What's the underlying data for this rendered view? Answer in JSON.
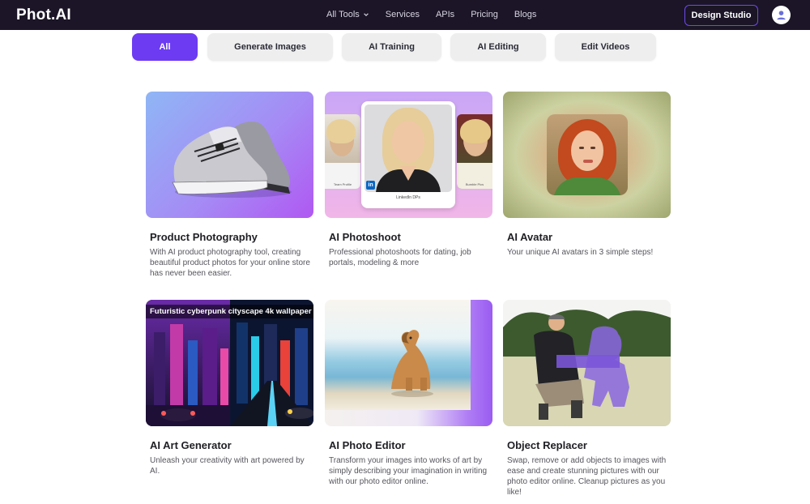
{
  "header": {
    "logo": "Phot.AI",
    "nav": [
      {
        "label": "All Tools",
        "dropdown": true
      },
      {
        "label": "Services"
      },
      {
        "label": "APIs"
      },
      {
        "label": "Pricing"
      },
      {
        "label": "Blogs"
      }
    ],
    "cta_label": "Design Studio",
    "avatar_icon": "user-icon"
  },
  "tabs": [
    {
      "label": "All",
      "active": true
    },
    {
      "label": "Generate Images"
    },
    {
      "label": "AI Training"
    },
    {
      "label": "AI Editing"
    },
    {
      "label": "Edit Videos"
    }
  ],
  "cards": [
    {
      "title": "Product Photography",
      "desc": "With AI product photography tool, creating beautiful product photos for your online store has never been easier."
    },
    {
      "title": "AI Photoshoot",
      "desc": "Professional photoshoots for dating, job portals, modeling & more",
      "image_label": "LinkedIn DPs",
      "side_label_left": "Team Profile",
      "side_label_right": "Bumble Pics"
    },
    {
      "title": "AI Avatar",
      "desc": "Your unique AI avatars in 3 simple steps!"
    },
    {
      "title": "AI Art Generator",
      "desc": "Unleash your creativity with art powered by AI.",
      "image_caption": "Futuristic cyberpunk cityscape 4k wallpaper"
    },
    {
      "title": "AI Photo Editor",
      "desc": "Transform your images into works of art by simply describing your imagination in writing with our photo editor online."
    },
    {
      "title": "Object Replacer",
      "desc": "Swap, remove or add objects to images with ease and create stunning pictures with our photo editor online. Cleanup pictures as you like!"
    }
  ],
  "colors": {
    "brand": "#6c3bf2",
    "navbar": "#1b1527"
  }
}
